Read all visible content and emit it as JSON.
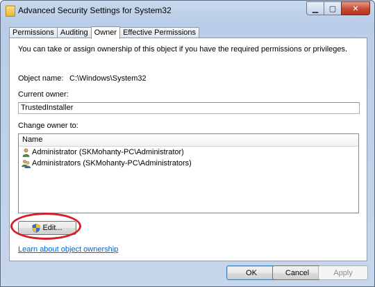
{
  "window": {
    "title": "Advanced Security Settings for System32"
  },
  "tabs": [
    {
      "label": "Permissions"
    },
    {
      "label": "Auditing"
    },
    {
      "label": "Owner"
    },
    {
      "label": "Effective Permissions"
    }
  ],
  "active_tab": "Owner",
  "owner_tab": {
    "description": "You can take or assign ownership of this object if you have the required permissions or privileges.",
    "object_name_label": "Object name:",
    "object_name_value": "C:\\Windows\\System32",
    "current_owner_label": "Current owner:",
    "current_owner_value": "TrustedInstaller",
    "change_owner_label": "Change owner to:",
    "list_header": "Name",
    "owners": [
      {
        "name": "Administrator (SKMohanty-PC\\Administrator)",
        "icon": "user-icon"
      },
      {
        "name": "Administrators (SKMohanty-PC\\Administrators)",
        "icon": "group-icon"
      }
    ],
    "edit_button": "Edit...",
    "learn_link": "Learn about object ownership"
  },
  "footer": {
    "ok": "OK",
    "cancel": "Cancel",
    "apply": "Apply"
  },
  "colors": {
    "highlight_ellipse": "#d4202a",
    "link": "#0066cc"
  }
}
